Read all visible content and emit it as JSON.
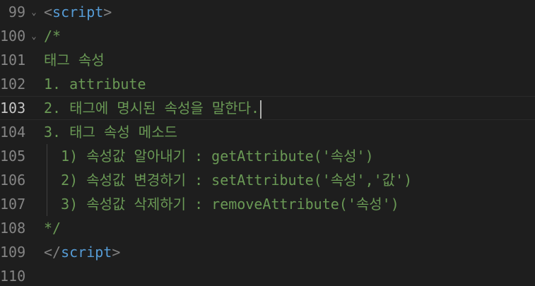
{
  "editor": {
    "lines": [
      {
        "num": "99",
        "open": "<",
        "tag": "script",
        "close": ">"
      },
      {
        "num": "100",
        "text": "/*"
      },
      {
        "num": "101",
        "text": "태그 속성"
      },
      {
        "num": "102",
        "text": "1. attribute"
      },
      {
        "num": "103",
        "text": "2. 태그에 명시된 속성을 말한다."
      },
      {
        "num": "104",
        "text": "3. 태그 속성 메소드"
      },
      {
        "num": "105",
        "text": "  1) 속성값 알아내기 : getAttribute('속성')"
      },
      {
        "num": "106",
        "text": "  2) 속성값 변경하기 : setAttribute('속성','값')"
      },
      {
        "num": "107",
        "text": "  3) 속성값 삭제하기 : removeAttribute('속성')"
      },
      {
        "num": "108",
        "text": "*/"
      },
      {
        "num": "109",
        "open": "</",
        "tag": "script",
        "close": ">"
      },
      {
        "num": "110",
        "text": ""
      }
    ],
    "fold_icon": "chevron-down-icon"
  }
}
